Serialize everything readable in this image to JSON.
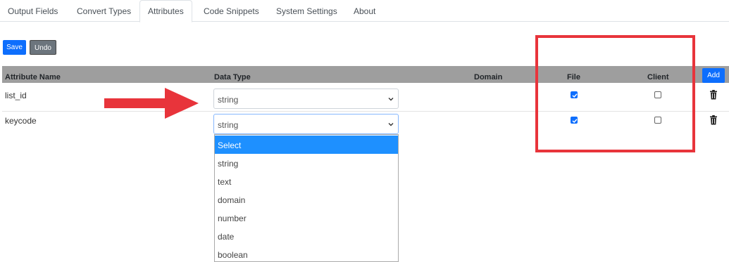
{
  "tabs": [
    {
      "label": "Output Fields",
      "active": false
    },
    {
      "label": "Convert Types",
      "active": false
    },
    {
      "label": "Attributes",
      "active": true
    },
    {
      "label": "Code Snippets",
      "active": false
    },
    {
      "label": "System Settings",
      "active": false
    },
    {
      "label": "About",
      "active": false
    }
  ],
  "toolbar": {
    "save_label": "Save",
    "undo_label": "Undo"
  },
  "table": {
    "headers": {
      "attribute_name": "Attribute Name",
      "data_type": "Data Type",
      "domain": "Domain",
      "file": "File",
      "client": "Client"
    },
    "add_label": "Add",
    "rows": [
      {
        "attribute_name": "list_id",
        "data_type": "string",
        "domain": "",
        "file": true,
        "client": false
      },
      {
        "attribute_name": "keycode",
        "data_type": "string",
        "domain": "",
        "file": true,
        "client": false
      }
    ]
  },
  "dropdown": {
    "options": [
      "Select",
      "string",
      "text",
      "domain",
      "number",
      "date",
      "boolean"
    ],
    "highlighted": "Select"
  },
  "colors": {
    "primary": "#0d6efd",
    "secondary": "#6c757d",
    "header_bg": "#9e9e9e",
    "highlight": "#1e90ff",
    "annotation_red": "#e8343b"
  },
  "icons": {
    "checkbox_check": "check-icon",
    "delete": "trash-icon",
    "select_caret": "chevron-down-icon",
    "annotation_arrow": "arrow-right-icon"
  }
}
